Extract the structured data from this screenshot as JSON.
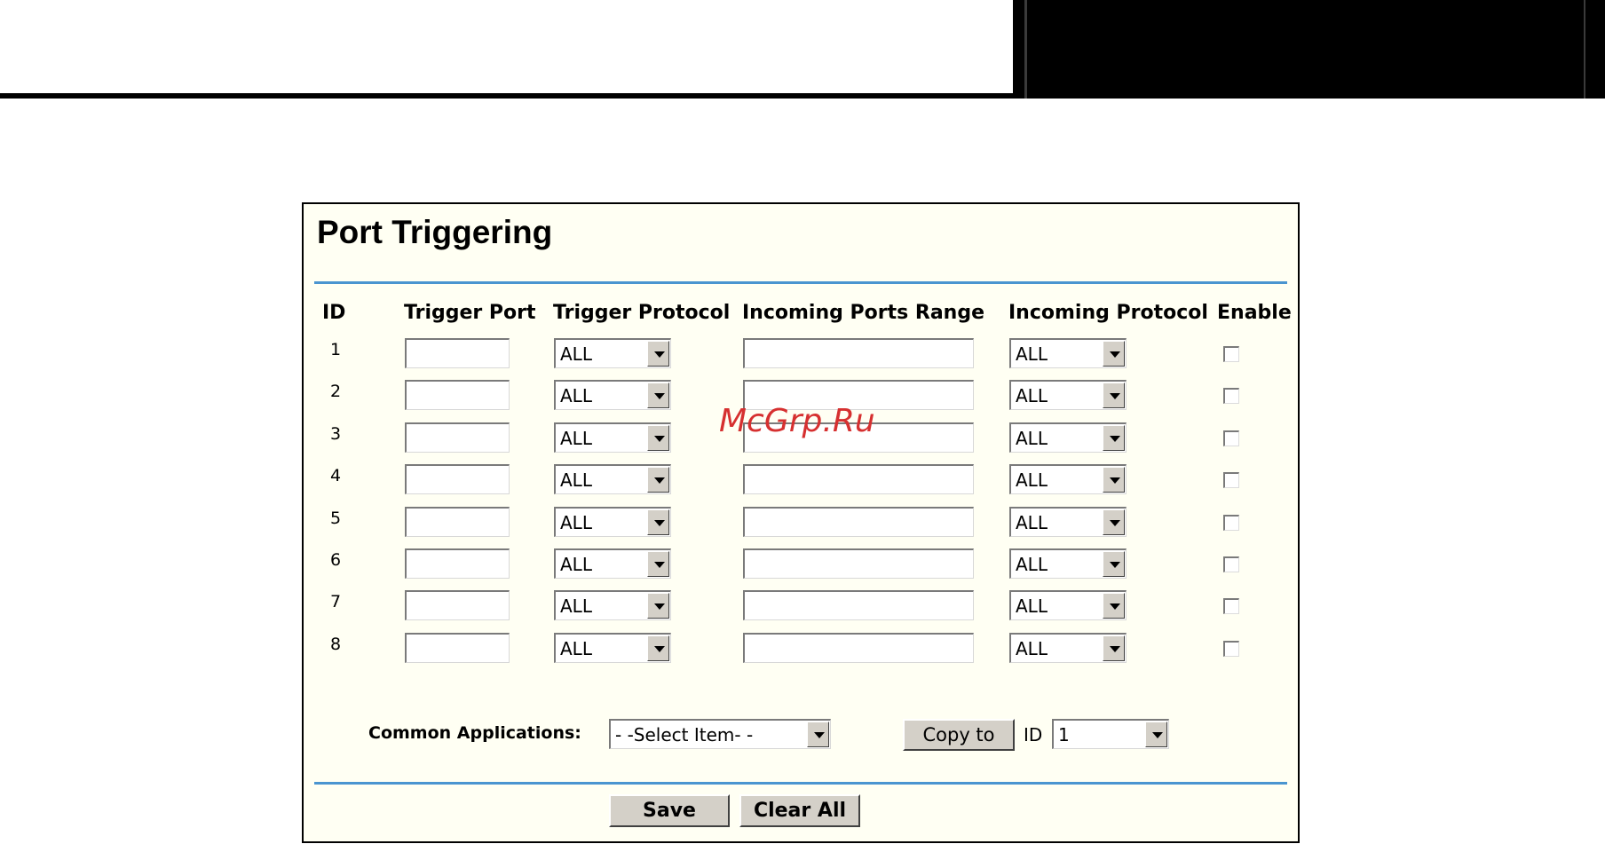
{
  "page_title": "Port Triggering",
  "columns": {
    "id": "ID",
    "trigger_port": "Trigger Port",
    "trigger_protocol": "Trigger Protocol",
    "incoming_ports_range": "Incoming Ports Range",
    "incoming_protocol": "Incoming Protocol",
    "enable": "Enable"
  },
  "rows": [
    {
      "id": "1",
      "trigger_port": "",
      "trigger_protocol": "ALL",
      "incoming_ports_range": "",
      "incoming_protocol": "ALL",
      "enabled": false
    },
    {
      "id": "2",
      "trigger_port": "",
      "trigger_protocol": "ALL",
      "incoming_ports_range": "",
      "incoming_protocol": "ALL",
      "enabled": false
    },
    {
      "id": "3",
      "trigger_port": "",
      "trigger_protocol": "ALL",
      "incoming_ports_range": "",
      "incoming_protocol": "ALL",
      "enabled": false
    },
    {
      "id": "4",
      "trigger_port": "",
      "trigger_protocol": "ALL",
      "incoming_ports_range": "",
      "incoming_protocol": "ALL",
      "enabled": false
    },
    {
      "id": "5",
      "trigger_port": "",
      "trigger_protocol": "ALL",
      "incoming_ports_range": "",
      "incoming_protocol": "ALL",
      "enabled": false
    },
    {
      "id": "6",
      "trigger_port": "",
      "trigger_protocol": "ALL",
      "incoming_ports_range": "",
      "incoming_protocol": "ALL",
      "enabled": false
    },
    {
      "id": "7",
      "trigger_port": "",
      "trigger_protocol": "ALL",
      "incoming_ports_range": "",
      "incoming_protocol": "ALL",
      "enabled": false
    },
    {
      "id": "8",
      "trigger_port": "",
      "trigger_protocol": "ALL",
      "incoming_ports_range": "",
      "incoming_protocol": "ALL",
      "enabled": false
    }
  ],
  "common_applications": {
    "label": "Common Applications:",
    "selected": "- -Select Item- -",
    "copy_to_label": "Copy to",
    "id_label": "ID",
    "id_selected": "1"
  },
  "buttons": {
    "save": "Save",
    "clear_all": "Clear All"
  },
  "watermark": "McGrp.Ru",
  "colors": {
    "panel_background": "#fffff3",
    "divider": "#4a95d0",
    "button_face": "#d4d0c8",
    "watermark": "#d63030"
  }
}
